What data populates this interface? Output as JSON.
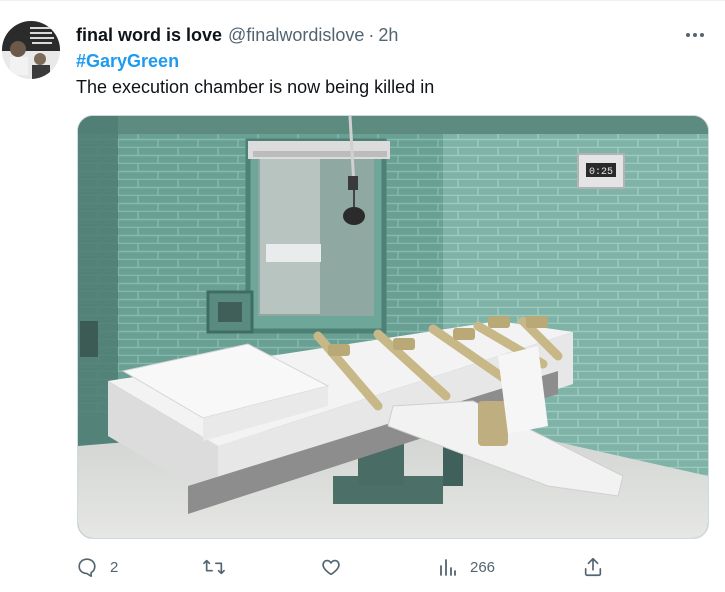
{
  "tweet": {
    "author_name": "final word is love",
    "handle": "@finalwordislove",
    "separator": "·",
    "time": "2h",
    "hashtag": "#GaryGreen",
    "text": "The execution chamber is now being killed in"
  },
  "actions": {
    "reply_count": "2",
    "views_count": "266"
  },
  "colors": {
    "link": "#1d9bf0",
    "secondary_text": "#536471",
    "primary_text": "#0f1419"
  },
  "icons": [
    "more-icon",
    "reply-icon",
    "retweet-icon",
    "like-icon",
    "views-icon",
    "share-icon"
  ]
}
